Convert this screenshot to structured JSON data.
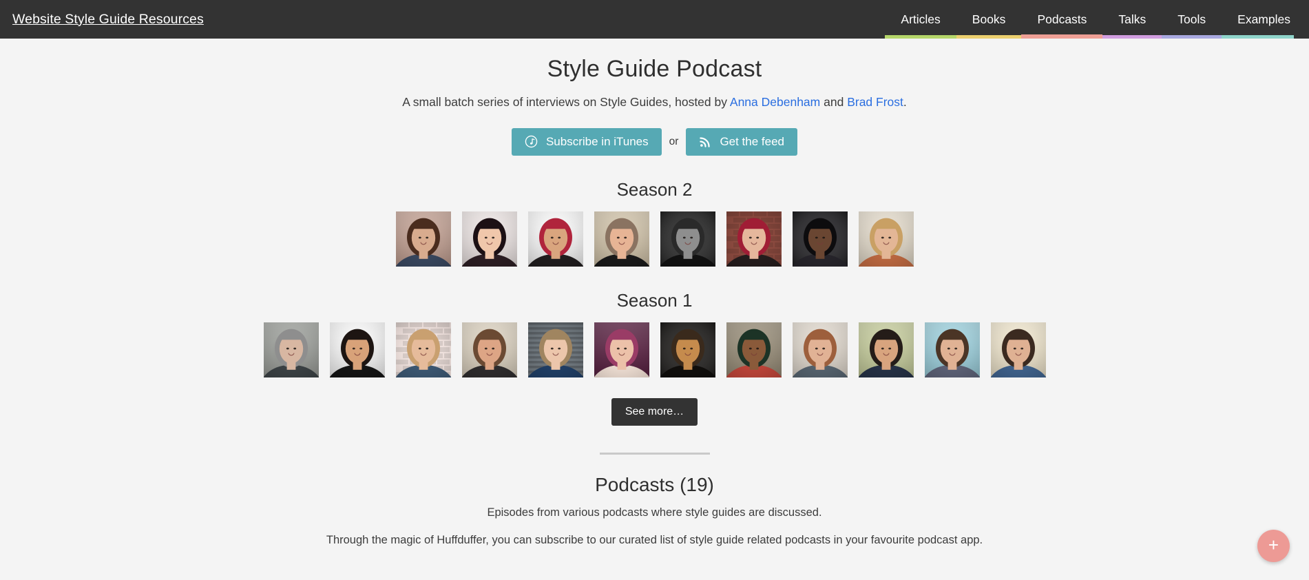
{
  "header": {
    "site_title": "Website Style Guide Resources",
    "nav": [
      {
        "label": "Articles",
        "underline_color": "#b5d66a",
        "active": false
      },
      {
        "label": "Books",
        "underline_color": "#ecd06f",
        "active": false
      },
      {
        "label": "Podcasts",
        "underline_color": "#ef9f95",
        "active": true
      },
      {
        "label": "Talks",
        "underline_color": "#d29ee0",
        "active": false
      },
      {
        "label": "Tools",
        "underline_color": "#a9a9e0",
        "active": false
      },
      {
        "label": "Examples",
        "underline_color": "#8fd4ca",
        "active": false
      }
    ]
  },
  "hero": {
    "title": "Style Guide Podcast",
    "subtitle_prefix": "A small batch series of interviews on Style Guides, hosted by ",
    "host_1": "Anna Debenham",
    "subtitle_join": " and ",
    "host_2": "Brad Frost",
    "subtitle_suffix": ".",
    "link_color": "#2a6ee0"
  },
  "subscribe": {
    "itunes_label": "Subscribe in iTunes",
    "itunes_icon": "itunes-podcast-icon",
    "or_label": "or",
    "feed_label": "Get the feed",
    "feed_icon": "rss-icon",
    "button_color": "#56a9b4"
  },
  "seasons": [
    {
      "heading": "Season 2",
      "episodes": [
        {
          "alt": "guest-portrait-1",
          "bg": "#c4a294",
          "skin": "#d8ab8e",
          "hair": "#4a2c1e",
          "cloth": "#37455c",
          "style": "indoor"
        },
        {
          "alt": "guest-portrait-2",
          "bg": "#efe7e6",
          "skin": "#f0c7ab",
          "hair": "#1c1014",
          "cloth": "#2b1d22",
          "style": "closeup"
        },
        {
          "alt": "guest-portrait-3",
          "bg": "#fbfbfb",
          "skin": "#d9a57e",
          "hair": "#b0243c",
          "cloth": "#201d1e",
          "style": "plain"
        },
        {
          "alt": "guest-portrait-4",
          "bg": "#d3c5ab",
          "skin": "#e7b495",
          "hair": "#8a7361",
          "cloth": "#191919",
          "style": "map"
        },
        {
          "alt": "guest-portrait-5",
          "bg": "#1b1b1b",
          "skin": "#8e8e8e",
          "hair": "#2a2a2a",
          "cloth": "#111111",
          "style": "mono"
        },
        {
          "alt": "guest-portrait-6",
          "bg": "#8b4a3f",
          "skin": "#e5b79c",
          "hair": "#a01d35",
          "cloth": "#241c1c",
          "style": "brick"
        },
        {
          "alt": "guest-portrait-7",
          "bg": "#17161a",
          "skin": "#6a4632",
          "hair": "#0d0c0e",
          "cloth": "#26242a",
          "style": "dark"
        },
        {
          "alt": "guest-portrait-8",
          "bg": "#e6ddcd",
          "skin": "#e3b696",
          "hair": "#c9a064",
          "cloth": "#b8663f",
          "style": "duo"
        }
      ]
    },
    {
      "heading": "Season 1",
      "episodes": [
        {
          "alt": "guest-portrait-9",
          "bg": "#9ea19c",
          "skin": "#d8b7a2",
          "hair": "#8e8e8e",
          "cloth": "#3a4043",
          "style": "grey"
        },
        {
          "alt": "guest-portrait-10",
          "bg": "#fbfbfb",
          "skin": "#d8a279",
          "hair": "#1d1512",
          "cloth": "#141414",
          "style": "plain"
        },
        {
          "alt": "guest-portrait-11",
          "bg": "#efe1dd",
          "skin": "#e6bb9b",
          "hair": "#c9a070",
          "cloth": "#3b5670",
          "style": "pattern"
        },
        {
          "alt": "guest-portrait-12",
          "bg": "#ded4c2",
          "skin": "#dda585",
          "hair": "#6b4a33",
          "cloth": "#2d2b2c",
          "style": "beard"
        },
        {
          "alt": "guest-portrait-13",
          "bg": "#6d757b",
          "skin": "#ecc6ab",
          "hair": "#a08560",
          "cloth": "#1f3d63",
          "style": "stripes"
        },
        {
          "alt": "guest-portrait-14",
          "bg": "#5b2243",
          "skin": "#ecc1a9",
          "hair": "#9a3c66",
          "cloth": "#e8d8cd",
          "style": "purple"
        },
        {
          "alt": "guest-portrait-15",
          "bg": "#12100e",
          "skin": "#c58b4d",
          "hair": "#3a2a1c",
          "cloth": "#100e0c",
          "style": "night"
        },
        {
          "alt": "guest-portrait-16",
          "bg": "#9a8f7a",
          "skin": "#8a5a3a",
          "hair": "#1c3326",
          "cloth": "#b84338",
          "style": "outdoor"
        },
        {
          "alt": "guest-portrait-17",
          "bg": "#e3dbd0",
          "skin": "#e1b295",
          "hair": "#9d5f3c",
          "cloth": "#53606b",
          "style": "warm"
        },
        {
          "alt": "guest-portrait-18",
          "bg": "#c8cf9e",
          "skin": "#d8a47e",
          "hair": "#241c18",
          "cloth": "#253044",
          "style": "green"
        },
        {
          "alt": "guest-portrait-19",
          "bg": "#9fd3e0",
          "skin": "#e0b294",
          "hair": "#4b3526",
          "cloth": "#5a5f73",
          "style": "sky"
        },
        {
          "alt": "guest-portrait-20",
          "bg": "#f2e8cf",
          "skin": "#dfb193",
          "hair": "#3b2a20",
          "cloth": "#3d5f88",
          "style": "antlers"
        }
      ]
    }
  ],
  "see_more": {
    "label": "See more…"
  },
  "podcasts_section": {
    "title": "Podcasts (19)",
    "subtitle": "Episodes from various podcasts where style guides are discussed.",
    "paragraph": "Through the magic of Huffduffer, you can subscribe to our curated list of style guide related podcasts in your favourite podcast app."
  },
  "fab": {
    "label": "+",
    "icon": "plus-icon",
    "color": "#ed9a95"
  }
}
